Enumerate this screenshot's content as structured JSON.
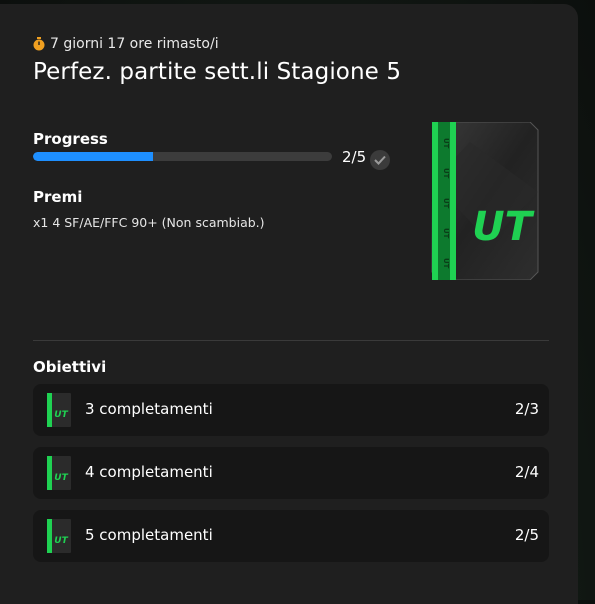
{
  "header": {
    "timer_icon": "stopwatch-icon",
    "time_remaining": "7 giorni 17 ore rimasto/i",
    "title": "Perfez. partite sett.li Stagione 5"
  },
  "progress": {
    "label": "Progress",
    "current": 2,
    "total": 5,
    "text": "2/5",
    "fraction": 0.4,
    "check_icon": "checkmark-icon",
    "bar_color": "#1e8fff"
  },
  "rewards": {
    "label": "Premi",
    "item": "x1 4 SF/AE/FFC 90+ (Non scambiab.)",
    "pack_logo": "UT",
    "pack_icon": "ut-pack-icon",
    "accent_color": "#1fd152"
  },
  "objectives": {
    "label": "Obiettivi",
    "items": [
      {
        "label": "3 completamenti",
        "count": "2/3",
        "icon": "ut-pack-icon"
      },
      {
        "label": "4 completamenti",
        "count": "2/4",
        "icon": "ut-pack-icon"
      },
      {
        "label": "5 completamenti",
        "count": "2/5",
        "icon": "ut-pack-icon"
      }
    ]
  }
}
